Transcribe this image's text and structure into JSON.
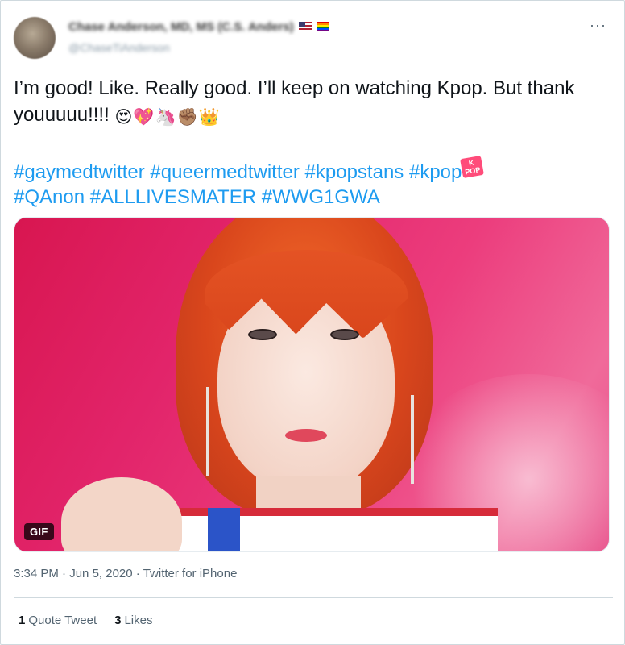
{
  "author": {
    "display_name": "Chase Anderson, MD, MS (C.S. Anders)",
    "handle": "@ChaseTiAnderson",
    "more_label": "···"
  },
  "tweet": {
    "text": "I’m good! Like. Really good. I’ll keep on watching Kpop. But thank youuuuu!!!!",
    "emojis": [
      "😍",
      "💖",
      "🦄",
      "✊🏽",
      "👑"
    ],
    "hashtags_line1": [
      "#gaymedtwitter",
      "#queermedtwitter",
      "#kpopstans",
      "#kpop"
    ],
    "hashtags_line2": [
      "#QAnon",
      "#ALLLIVESMATER",
      "#WWG1GWA"
    ],
    "kpop_badge": "K POP"
  },
  "media": {
    "badge": "GIF"
  },
  "meta": {
    "time": "3:34 PM",
    "date": "Jun 5, 2020",
    "source": "Twitter for iPhone",
    "separator": "·"
  },
  "stats": {
    "quote_count": "1",
    "quote_label": "Quote Tweet",
    "like_count": "3",
    "like_label": "Likes"
  },
  "colors": {
    "link": "#1d9bf0",
    "text": "#0f1419",
    "muted": "#536471",
    "border": "#cfd9de"
  }
}
